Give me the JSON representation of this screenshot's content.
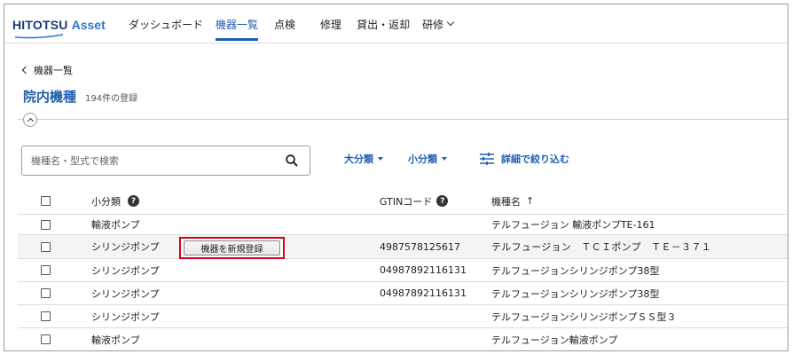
{
  "app": {
    "logo_main": "HITOTSU",
    "logo_sub": "Asset",
    "brand_color": "#1b3a7a",
    "accent_color": "#1f5fb0"
  },
  "nav": {
    "items": [
      {
        "label": "ダッシュボード",
        "active": false
      },
      {
        "label": "機器一覧",
        "active": true
      },
      {
        "label": "点検",
        "active": false
      },
      {
        "label": "修理",
        "active": false
      },
      {
        "label": "貸出・返却",
        "active": false
      },
      {
        "label": "研修",
        "active": false,
        "has_dropdown": true
      }
    ]
  },
  "page": {
    "back_label": "機器一覧",
    "title": "院内機種",
    "count": "194件の登録"
  },
  "filters": {
    "search_placeholder": "機種名・型式で検索",
    "search_value": "",
    "major_category": "大分類",
    "minor_category": "小分類",
    "detail_filter": "詳細で絞り込む"
  },
  "table": {
    "columns": {
      "category": "小分類",
      "gtin": "GTINコード",
      "name": "機種名",
      "name_sort": "↑"
    },
    "rows": [
      {
        "category": "輸液ポンプ",
        "gtin": "",
        "name": "テルフュージョン 輸液ポンプTE-161"
      },
      {
        "category": "シリンジポンプ",
        "gtin": "4987578125617",
        "name": "テルフュージョン　ＴＣＩポンプ　ＴＥ－３７１"
      },
      {
        "category": "シリンジポンプ",
        "gtin": "04987892116131",
        "name": "テルフュージョンシリンジポンプ38型"
      },
      {
        "category": "シリンジポンプ",
        "gtin": "04987892116131",
        "name": "テルフュージョンシリンジポンプ38型"
      },
      {
        "category": "シリンジポンプ",
        "gtin": "",
        "name": "テルフュージョンシリンジポンプＳＳ型３"
      },
      {
        "category": "輸液ポンプ",
        "gtin": "",
        "name": "テルフュージョン輸液ポンプ"
      }
    ]
  },
  "overlay": {
    "new_register_label": "機器を新規登録",
    "highlight_color": "#d0021b"
  }
}
